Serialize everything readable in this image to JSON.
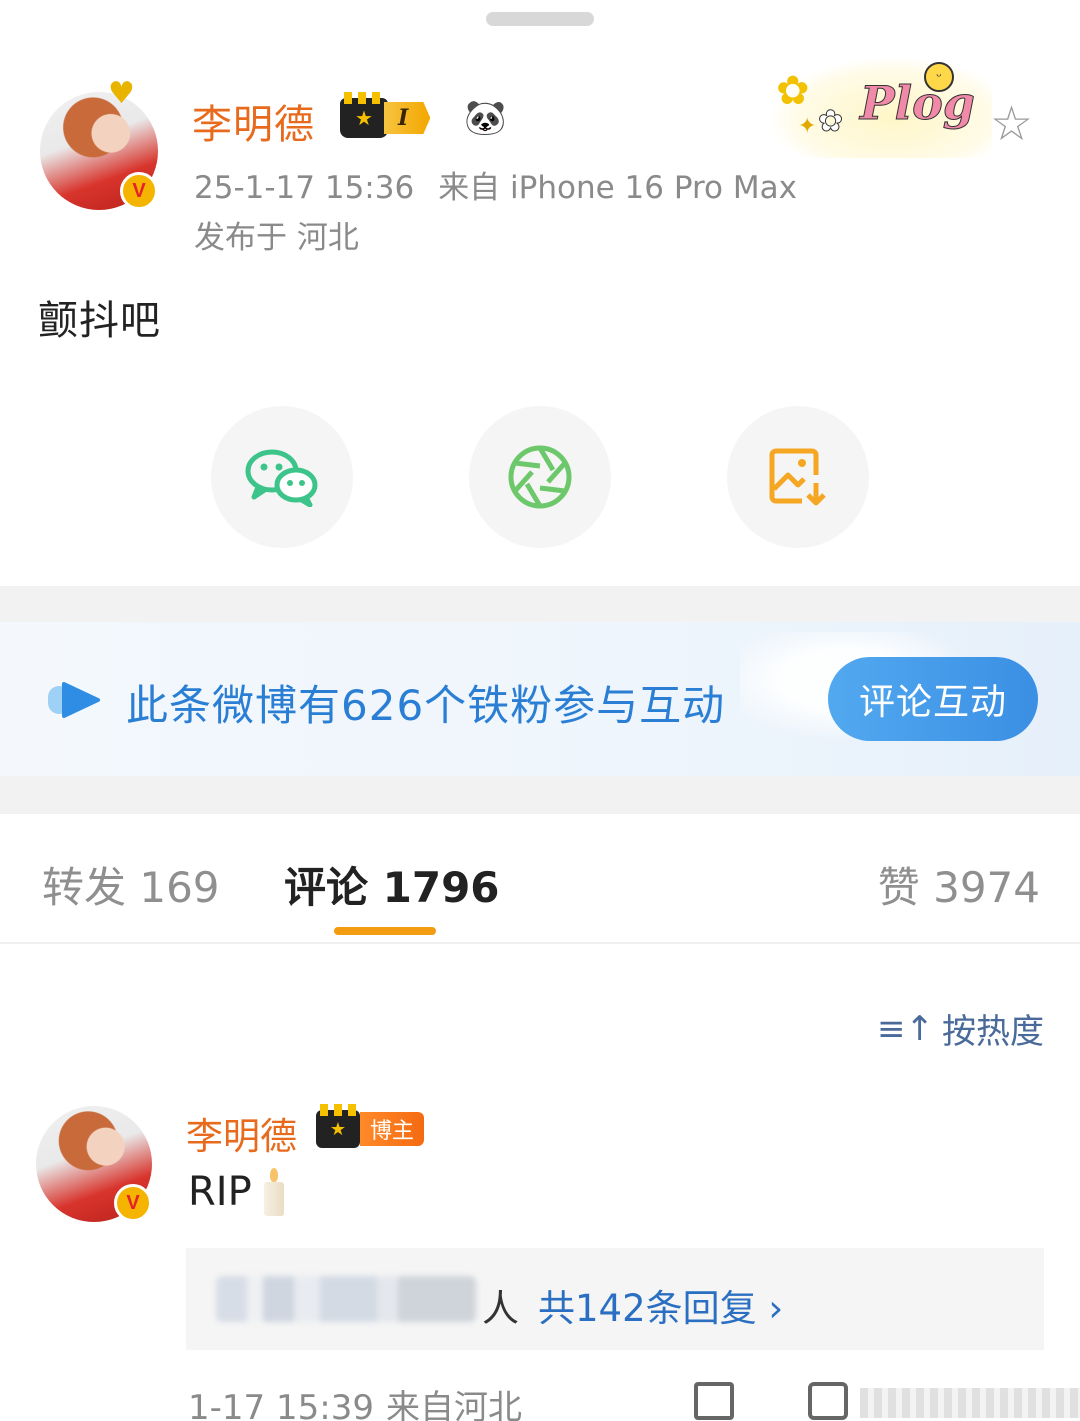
{
  "post": {
    "author": {
      "name": "李明德",
      "level_badge": "I",
      "verified_mark": "V",
      "emoji_badge": "🐼"
    },
    "timestamp": "25-1-17 15:36",
    "source": "来自 iPhone 16 Pro Max",
    "location": "发布于 河北",
    "text": "颤抖吧",
    "decoration_word": "Plog",
    "favorite_glyph": "☆"
  },
  "share": {
    "buttons": [
      {
        "name": "wechat-share",
        "icon": "wechat-icon",
        "color": "#3cc48a"
      },
      {
        "name": "moments-share",
        "icon": "camera-aperture-icon",
        "color": "#6cc86a"
      },
      {
        "name": "save-image",
        "icon": "image-download-icon",
        "color": "#f5a623"
      }
    ]
  },
  "fans_banner": {
    "text": "此条微博有626个铁粉参与互动",
    "button_label": "评论互动",
    "accent": "#2a7fd4"
  },
  "tabs": {
    "repost": "转发 169",
    "comment": "评论 1796",
    "like": "赞 3974",
    "active_color": "#f39c12"
  },
  "sort": {
    "label": "按热度",
    "icon_glyph": "≡↑"
  },
  "comment": {
    "author": "李明德",
    "tag": "博主",
    "verified_mark": "V",
    "text": "RIP",
    "reply_suffix": "人",
    "reply_link": "共142条回复 ›",
    "time": "1-17 15:39",
    "location": "来自河北"
  }
}
